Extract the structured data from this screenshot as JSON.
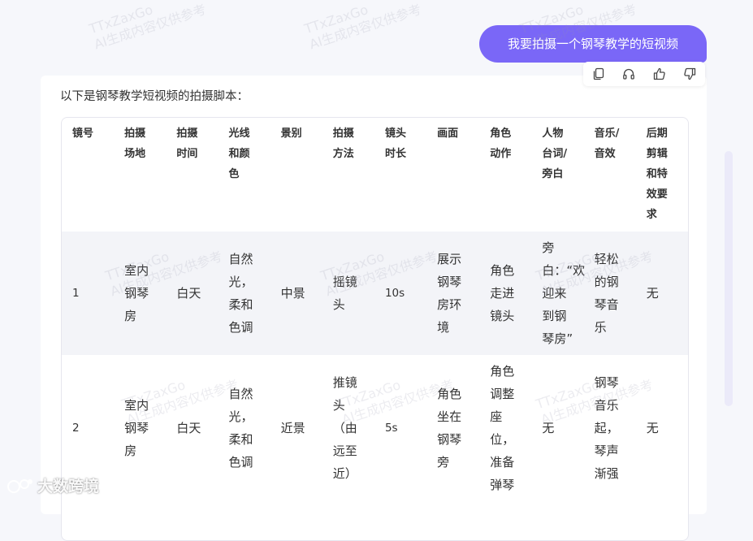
{
  "user_message": "我要拍摄一个钢琴教学的短视频",
  "message_actions": [
    {
      "name": "copy-icon"
    },
    {
      "name": "headphones-icon"
    },
    {
      "name": "thumbs-up-icon"
    },
    {
      "name": "thumbs-down-icon"
    }
  ],
  "answer": {
    "intro": "以下是钢琴教学短视频的拍摄脚本：",
    "table": {
      "headers": [
        "镜号",
        "拍摄场地",
        "拍摄时间",
        "光线和颜色",
        "景别",
        "拍摄方法",
        "镜头时长",
        "画面",
        "角色动作",
        "人物台词/旁白",
        "音乐/音效",
        "后期剪辑和特效要求"
      ],
      "rows": [
        [
          "1",
          "室内钢琴房",
          "白天",
          "自然光，柔和色调",
          "中景",
          "摇镜头",
          "10s",
          "展示钢琴房环境",
          "角色走进镜头",
          "旁白：“欢迎来到钢琴房”",
          "轻松的钢琴音乐",
          "无"
        ],
        [
          "2",
          "室内钢琴房",
          "白天",
          "自然光，柔和色调",
          "近景",
          "推镜头（由远至近）",
          "5s",
          "角色坐在钢琴旁",
          "角色调整座位，准备弹琴",
          "无",
          "钢琴音乐起，琴声渐强",
          "无"
        ]
      ]
    }
  },
  "watermark": {
    "line1": "TTxZaxGo",
    "line2": "AI生成内容仅供参考"
  },
  "brand": {
    "name": "大数跨境"
  },
  "colors": {
    "accent": "#7a67f7",
    "row_alt": "#f3f4f8"
  }
}
